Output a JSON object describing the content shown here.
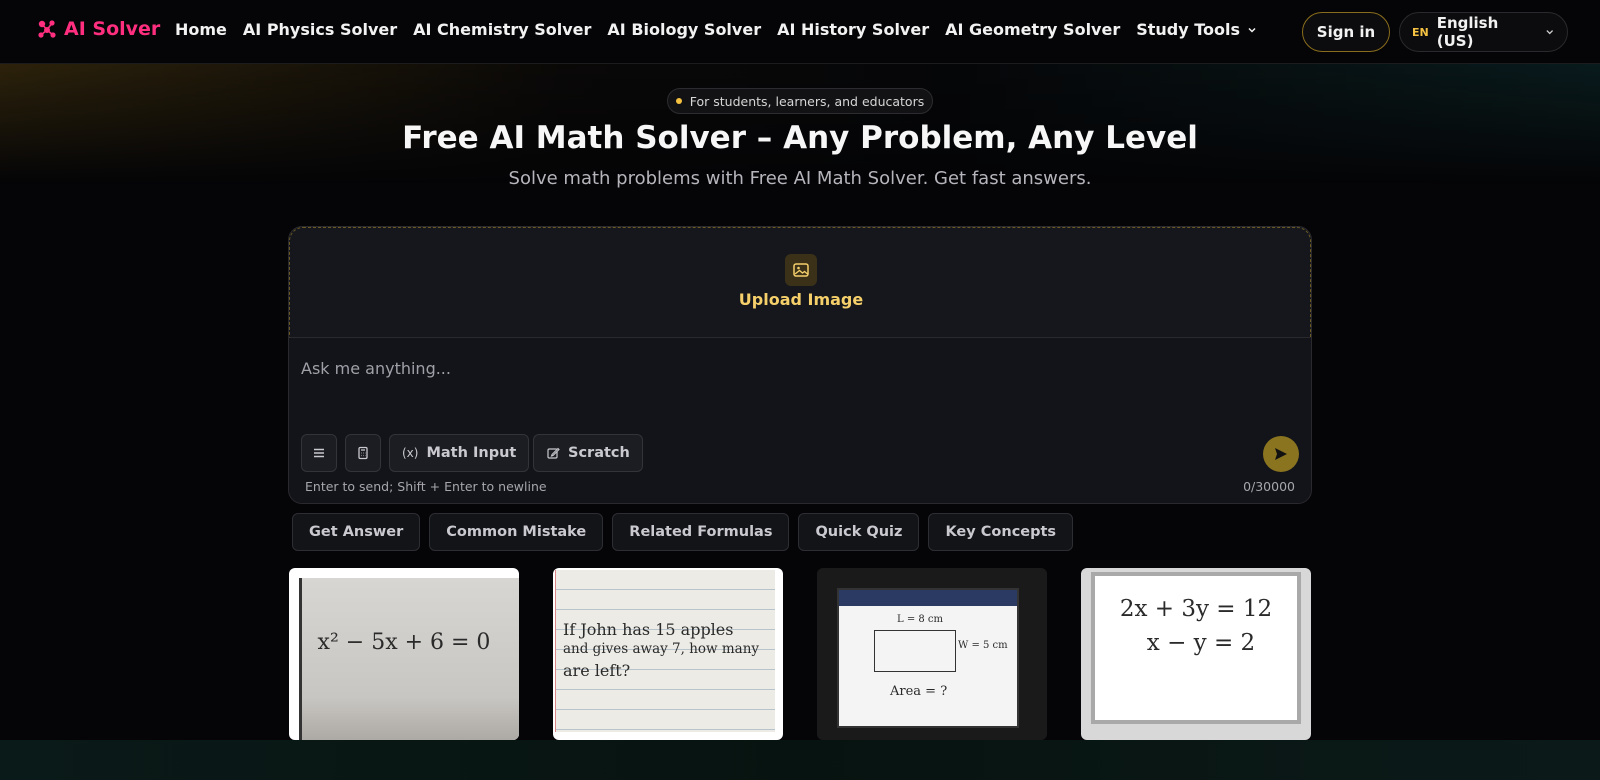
{
  "nav": {
    "logo_text": "AI Solver",
    "links": [
      "Home",
      "AI Physics Solver",
      "AI Chemistry Solver",
      "AI Biology Solver",
      "AI History Solver",
      "AI Geometry Solver",
      "Study Tools"
    ],
    "signin_label": "Sign in",
    "language_code": "EN",
    "language_name": "English (US)"
  },
  "hero": {
    "badge": "For students, learners, and educators",
    "title": "Free AI Math Solver – Any Problem, Any Level",
    "subtitle": "Solve math problems with Free AI Math Solver. Get fast answers."
  },
  "composer": {
    "upload_label": "Upload Image",
    "placeholder": "Ask me anything...",
    "math_input_label": "Math Input",
    "scratch_label": "Scratch",
    "hint": "Enter to send; Shift + Enter to newline",
    "counter": "0/30000"
  },
  "chips": [
    "Get Answer",
    "Common Mistake",
    "Related Formulas",
    "Quick Quiz",
    "Key Concepts"
  ],
  "samples": {
    "s1": "x² − 5x + 6 = 0",
    "s2": [
      "If John has 15 apples",
      "and gives away 7, how many",
      "are left?"
    ],
    "s3": {
      "length": "L = 8 cm",
      "width": "W = 5 cm",
      "question": "Area = ?"
    },
    "s4": [
      "2x + 3y = 12",
      "x − y = 2"
    ]
  },
  "colors": {
    "brand": "#ff2e7e",
    "accent": "#f5c242",
    "send": "#8a7420"
  }
}
